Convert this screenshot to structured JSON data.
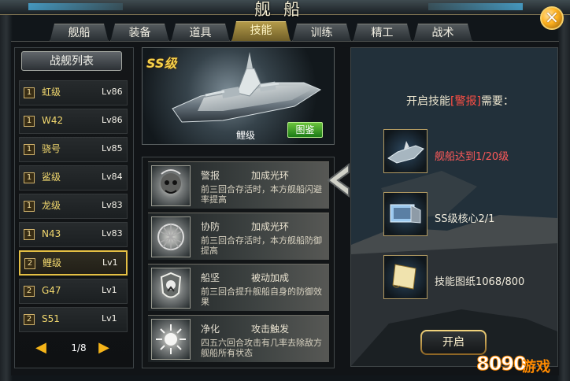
{
  "window": {
    "title": "舰船",
    "close_icon": "x-icon"
  },
  "tabs": [
    {
      "label": "舰船",
      "active": false
    },
    {
      "label": "装备",
      "active": false
    },
    {
      "label": "道具",
      "active": false
    },
    {
      "label": "技能",
      "active": true
    },
    {
      "label": "训练",
      "active": false
    },
    {
      "label": "精工",
      "active": false
    },
    {
      "label": "战术",
      "active": false
    }
  ],
  "left_panel": {
    "header": "战舰列表",
    "ships": [
      {
        "slot": "1",
        "name": "虹级",
        "level": "Lv86",
        "selected": false
      },
      {
        "slot": "1",
        "name": "W42",
        "level": "Lv86",
        "selected": false
      },
      {
        "slot": "1",
        "name": "骁号",
        "level": "Lv85",
        "selected": false
      },
      {
        "slot": "1",
        "name": "鲨级",
        "level": "Lv84",
        "selected": false
      },
      {
        "slot": "1",
        "name": "龙级",
        "level": "Lv83",
        "selected": false
      },
      {
        "slot": "1",
        "name": "N43",
        "level": "Lv83",
        "selected": false
      },
      {
        "slot": "2",
        "name": "鲤级",
        "level": "Lv1",
        "selected": true
      },
      {
        "slot": "2",
        "name": "G47",
        "level": "Lv1",
        "selected": false
      },
      {
        "slot": "2",
        "name": "S51",
        "level": "Lv1",
        "selected": false
      }
    ],
    "pagination": {
      "text": "1/8",
      "prev_icon": "left-arrow-icon",
      "next_icon": "right-arrow-icon"
    }
  },
  "preview": {
    "grade": "SS级",
    "ship_name": "鲤级",
    "guide_button": "图鉴"
  },
  "skills": [
    {
      "icon": "skull-icon",
      "name": "警报",
      "type": "加成光环",
      "desc": "前三回合存活时，本方舰船闪避率提高"
    },
    {
      "icon": "mesh-sphere-icon",
      "name": "协防",
      "type": "加成光环",
      "desc": "前三回合存活时，本方舰船防御提高"
    },
    {
      "icon": "shield-icon",
      "name": "船坚",
      "type": "被动加成",
      "desc": "前三回合提升舰船自身的防御效果"
    },
    {
      "icon": "purify-icon",
      "name": "净化",
      "type": "攻击触发",
      "desc": "四五六回合攻击有几率去除敌方舰船所有状态"
    }
  ],
  "requirements": {
    "title_prefix": "开启技能",
    "title_highlight": "[警报]",
    "title_suffix": "需要：",
    "items": [
      {
        "icon": "ship-icon",
        "text": "舰船达到1/20级",
        "red": true
      },
      {
        "icon": "core-icon",
        "text": "SS级核心2/1",
        "red": false
      },
      {
        "icon": "scroll-icon",
        "text": "技能图纸1068/800",
        "red": false
      }
    ],
    "button": "开启"
  },
  "watermark": {
    "big": "8090",
    "small": "游戏"
  },
  "colors": {
    "accent_gold": "#e4bf44",
    "warning_red": "#ff5a5a",
    "green_button": "#1b7b16"
  }
}
